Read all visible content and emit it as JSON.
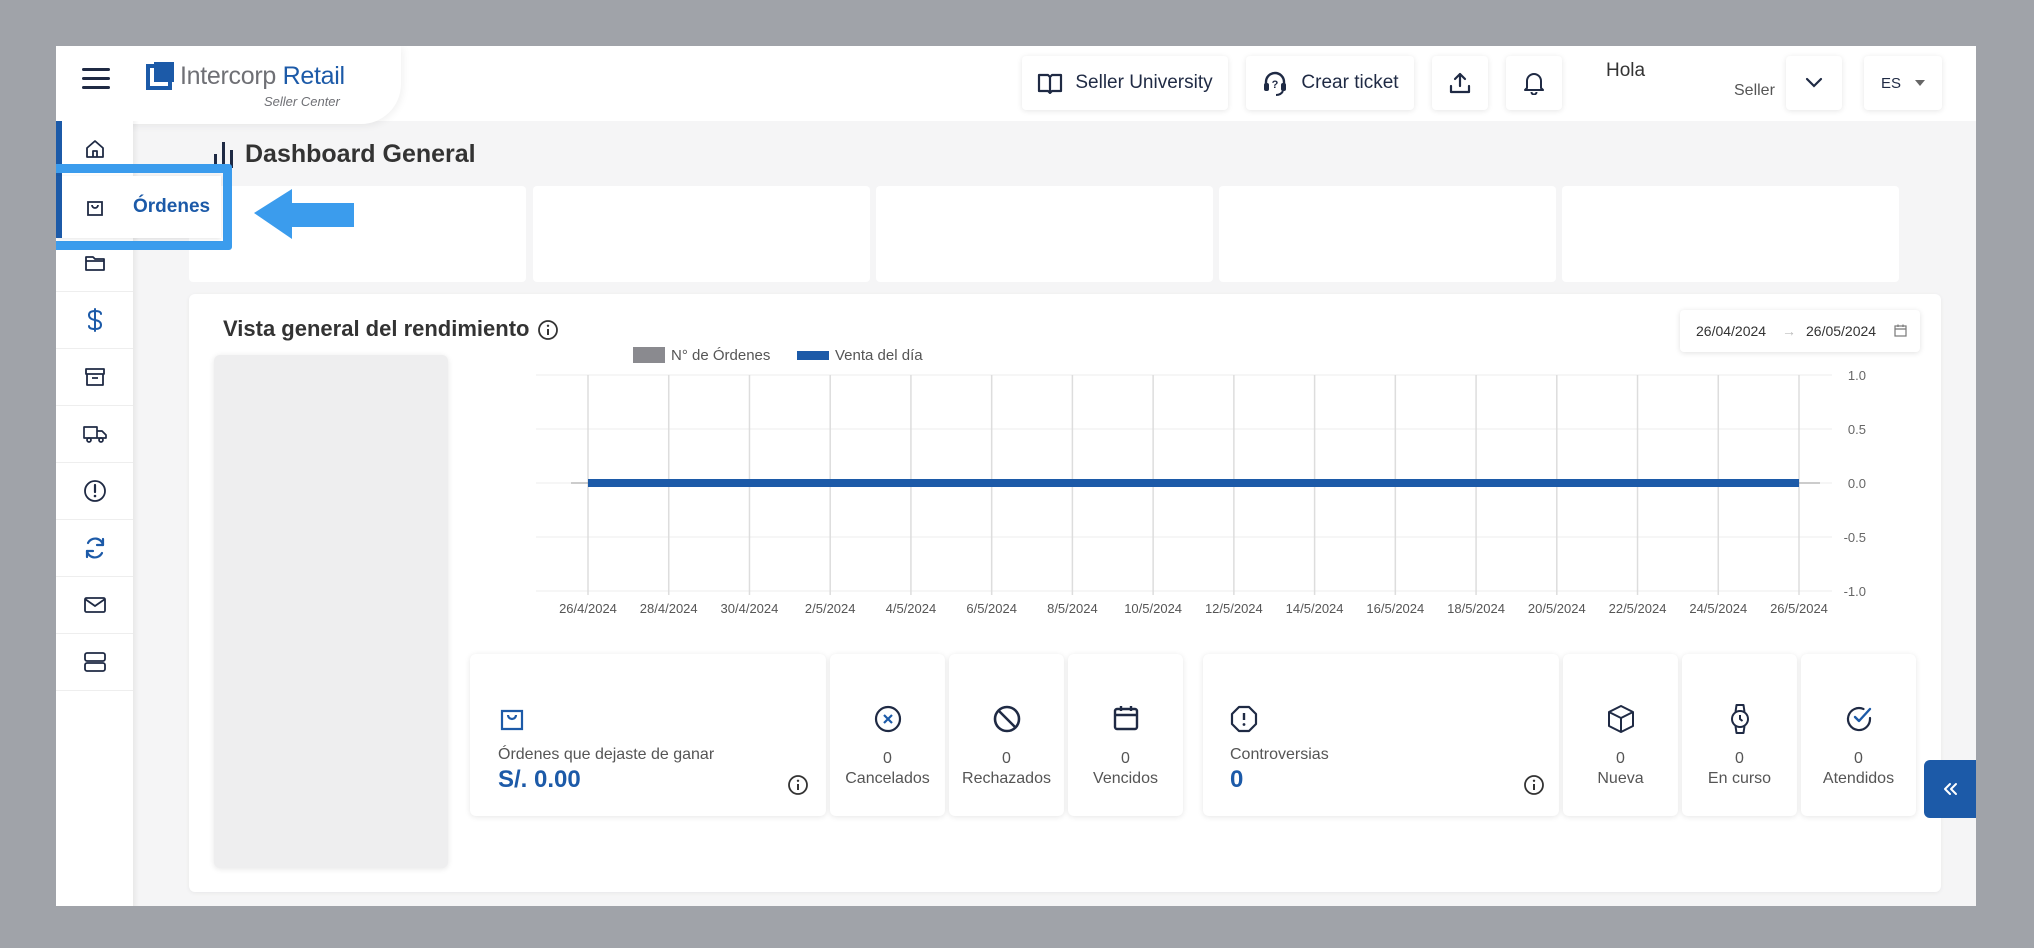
{
  "brand": {
    "name_part1": "Intercorp",
    "name_part2": "Retail",
    "subtitle": "Seller Center"
  },
  "header": {
    "seller_university": "Seller University",
    "crear_ticket": "Crear ticket",
    "greeting": "Hola",
    "role": "Seller",
    "language": "ES"
  },
  "sidebar": {
    "items": [
      {
        "icon": "home-icon"
      },
      {
        "icon": "shopping-bag-icon"
      },
      {
        "icon": "folder-icon"
      },
      {
        "icon": "dollar-icon"
      },
      {
        "icon": "archive-icon"
      },
      {
        "icon": "truck-icon"
      },
      {
        "icon": "alert-circle-icon"
      },
      {
        "icon": "refresh-icon"
      },
      {
        "icon": "mail-icon"
      },
      {
        "icon": "server-icon"
      }
    ],
    "popup_label": "Órdenes"
  },
  "page": {
    "title": "Dashboard General"
  },
  "panel": {
    "title": "Vista general del rendimiento",
    "date_start": "26/04/2024",
    "date_end": "26/05/2024"
  },
  "chart_data": {
    "type": "line",
    "series": [
      {
        "name": "N° de Órdenes",
        "color": "#8a8a8f",
        "values": [
          0,
          0,
          0,
          0,
          0,
          0,
          0,
          0,
          0,
          0,
          0,
          0,
          0,
          0,
          0,
          0
        ]
      },
      {
        "name": "Venta del día",
        "color": "#1c5aa8",
        "values": [
          0,
          0,
          0,
          0,
          0,
          0,
          0,
          0,
          0,
          0,
          0,
          0,
          0,
          0,
          0,
          0
        ]
      }
    ],
    "categories": [
      "26/4/2024",
      "28/4/2024",
      "30/4/2024",
      "2/5/2024",
      "4/5/2024",
      "6/5/2024",
      "8/5/2024",
      "10/5/2024",
      "12/5/2024",
      "14/5/2024",
      "16/5/2024",
      "18/5/2024",
      "20/5/2024",
      "22/5/2024",
      "24/5/2024",
      "26/5/2024"
    ],
    "y_ticks": [
      "1.0",
      "0.5",
      "0.0",
      "-0.5",
      "-1.0"
    ],
    "ylim": [
      -1,
      1
    ],
    "legend_position": "top-left",
    "grid": true
  },
  "stats": {
    "lost": {
      "label": "Órdenes que dejaste de ganar",
      "value": "S/. 0.00"
    },
    "cancelados": {
      "value": "0",
      "label": "Cancelados"
    },
    "rechazados": {
      "value": "0",
      "label": "Rechazados"
    },
    "vencidos": {
      "value": "0",
      "label": "Vencidos"
    },
    "controversias": {
      "label": "Controversias",
      "value": "0"
    },
    "nueva": {
      "value": "0",
      "label": "Nueva"
    },
    "en_curso": {
      "value": "0",
      "label": "En curso"
    },
    "atendidos": {
      "value": "0",
      "label": "Atendidos"
    }
  }
}
